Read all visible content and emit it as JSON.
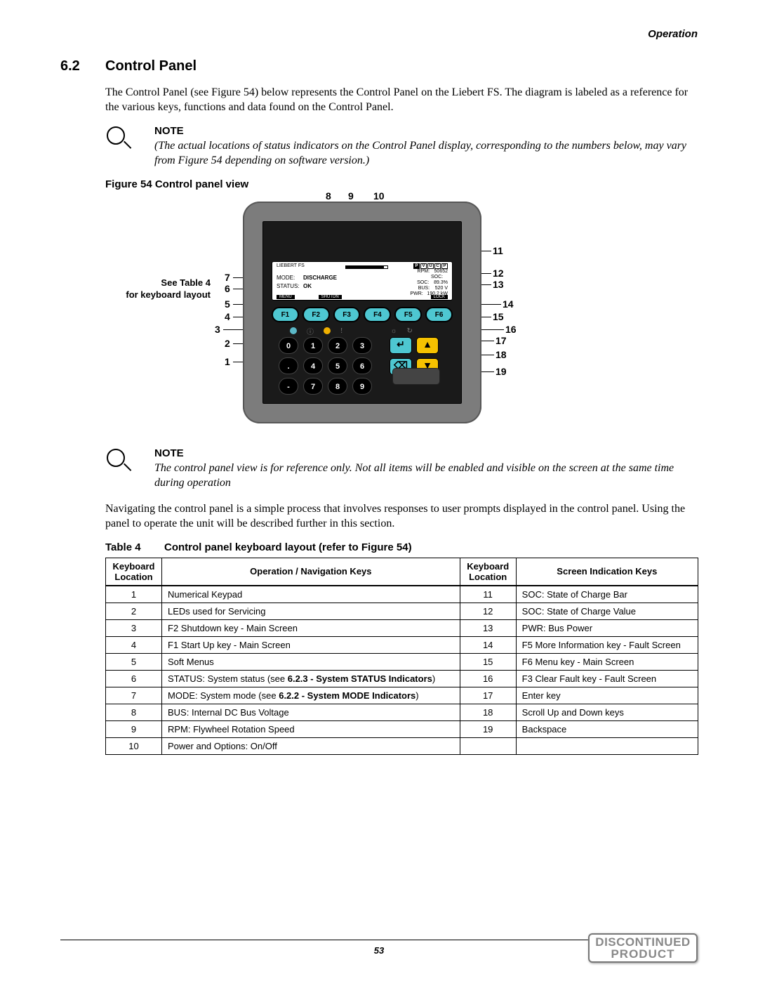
{
  "header": {
    "section": "Operation"
  },
  "title": {
    "num": "6.2",
    "text": "Control Panel"
  },
  "intro": "The Control Panel (see Figure 54) below represents the Control Panel on the Liebert FS. The diagram is labeled as a reference for the various keys, functions and data found on the Control Panel.",
  "note1": {
    "title": "NOTE",
    "text": "(The actual locations of status indicators on the Control Panel display, corresponding to the numbers below, may vary from Figure 54 depending on software version.)"
  },
  "figure": {
    "caption": "Figure 54  Control panel view",
    "aside": "See Table 4\nfor keyboard layout",
    "callouts_top": [
      "8",
      "9",
      "10"
    ],
    "callouts_left": [
      "7",
      "6",
      "5",
      "4",
      "3",
      "2",
      "1"
    ],
    "callouts_right": [
      "11",
      "12",
      "13",
      "14",
      "15",
      "16",
      "17",
      "18",
      "19"
    ]
  },
  "lcd": {
    "product": "LIEBERT FS",
    "indicator_letters": [
      "P",
      "V",
      "U",
      "C",
      "P"
    ],
    "mode_label": "MODE:",
    "mode_value": "DISCHARGE",
    "status_label": "STATUS:",
    "status_value": "OK",
    "menus": [
      "MENU",
      "SHUTDN",
      "",
      "",
      "LOCK"
    ],
    "right": [
      {
        "lab": "RPM:",
        "val": "50652"
      },
      {
        "lab": "SOC:",
        "val": ""
      },
      {
        "lab": "SOC:",
        "val": "89.3%"
      },
      {
        "lab": "BUS:",
        "val": "520 V"
      },
      {
        "lab": "PWR:",
        "val": "190.2 kW"
      }
    ]
  },
  "fkeys": [
    "F1",
    "F2",
    "F3",
    "F4",
    "F5",
    "F6"
  ],
  "numkeys": [
    "0",
    "1",
    "2",
    "3",
    ".",
    "4",
    "5",
    "6",
    "-",
    "7",
    "8",
    "9"
  ],
  "nav": {
    "enter": "↵",
    "up": "▲",
    "back": "⌫",
    "down": "▼"
  },
  "note2": {
    "title": "NOTE",
    "text": "The control panel view is for reference only. Not all items will be enabled and visible on the screen at the same time during operation"
  },
  "para2": "Navigating the control panel is a simple process that involves responses to user prompts displayed in the control panel. Using the panel to operate the unit will be described further in this section.",
  "table": {
    "num": "Table 4",
    "caption": "Control panel keyboard layout (refer to Figure 54)",
    "head": [
      "Keyboard Location",
      "Operation / Navigation Keys",
      "Keyboard Location",
      "Screen Indication Keys"
    ],
    "rows": [
      [
        "1",
        "Numerical Keypad",
        "11",
        "SOC: State of Charge Bar"
      ],
      [
        "2",
        "LEDs used for Servicing",
        "12",
        "SOC: State of Charge Value"
      ],
      [
        "3",
        "F2 Shutdown key - Main Screen",
        "13",
        "PWR: Bus Power"
      ],
      [
        "4",
        "F1 Start Up key - Main Screen",
        "14",
        "F5 More Information key - Fault Screen"
      ],
      [
        "5",
        "Soft Menus",
        "15",
        "F6 Menu key - Main Screen"
      ],
      [
        "6",
        "STATUS: System status (see <b>6.2.3 - System STATUS Indicators</b>)",
        "16",
        "F3 Clear Fault key - Fault Screen"
      ],
      [
        "7",
        "MODE: System mode (see <b>6.2.2 - System MODE Indicators</b>)",
        "17",
        "Enter key"
      ],
      [
        "8",
        "BUS: Internal DC Bus Voltage",
        "18",
        "Scroll Up and Down keys"
      ],
      [
        "9",
        "RPM: Flywheel Rotation Speed",
        "19",
        "Backspace"
      ],
      [
        "10",
        "Power and Options: On/Off",
        "",
        ""
      ]
    ]
  },
  "pagenum": "53",
  "stamp": {
    "l1": "DISCONTINUED",
    "l2": "PRODUCT"
  }
}
